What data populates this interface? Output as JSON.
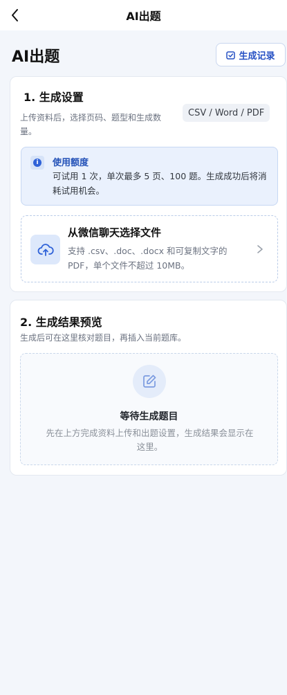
{
  "nav": {
    "title": "AI出题",
    "back_icon": "chevron-left-icon"
  },
  "header": {
    "title": "AI出题",
    "history_button": {
      "label": "生成记录",
      "icon": "calendar-check-icon"
    }
  },
  "settings": {
    "title": "1. 生成设置",
    "description": "上传资料后，选择页码、题型和生成数量。",
    "formats_badge": "CSV / Word / PDF",
    "quota": {
      "icon": "info-icon",
      "title": "使用额度",
      "text": "可试用 1 次，单次最多 5 页、100 题。生成成功后将消耗试用机会。"
    },
    "upload": {
      "icon": "cloud-upload-icon",
      "title": "从微信聊天选择文件",
      "text": "支持 .csv、.doc、.docx 和可复制文字的 PDF，单个文件不超过 10MB。",
      "chevron_icon": "chevron-right-icon"
    }
  },
  "preview": {
    "title": "2. 生成结果预览",
    "description": "生成后可在这里核对题目，再插入当前题库。",
    "empty": {
      "icon": "edit-icon",
      "title": "等待生成题目",
      "text": "先在上方完成资料上传和出题设置，生成结果会显示在这里。"
    }
  },
  "colors": {
    "accent": "#2550c4",
    "background": "#f3f6fb",
    "info_bg": "#eaf1fd"
  }
}
